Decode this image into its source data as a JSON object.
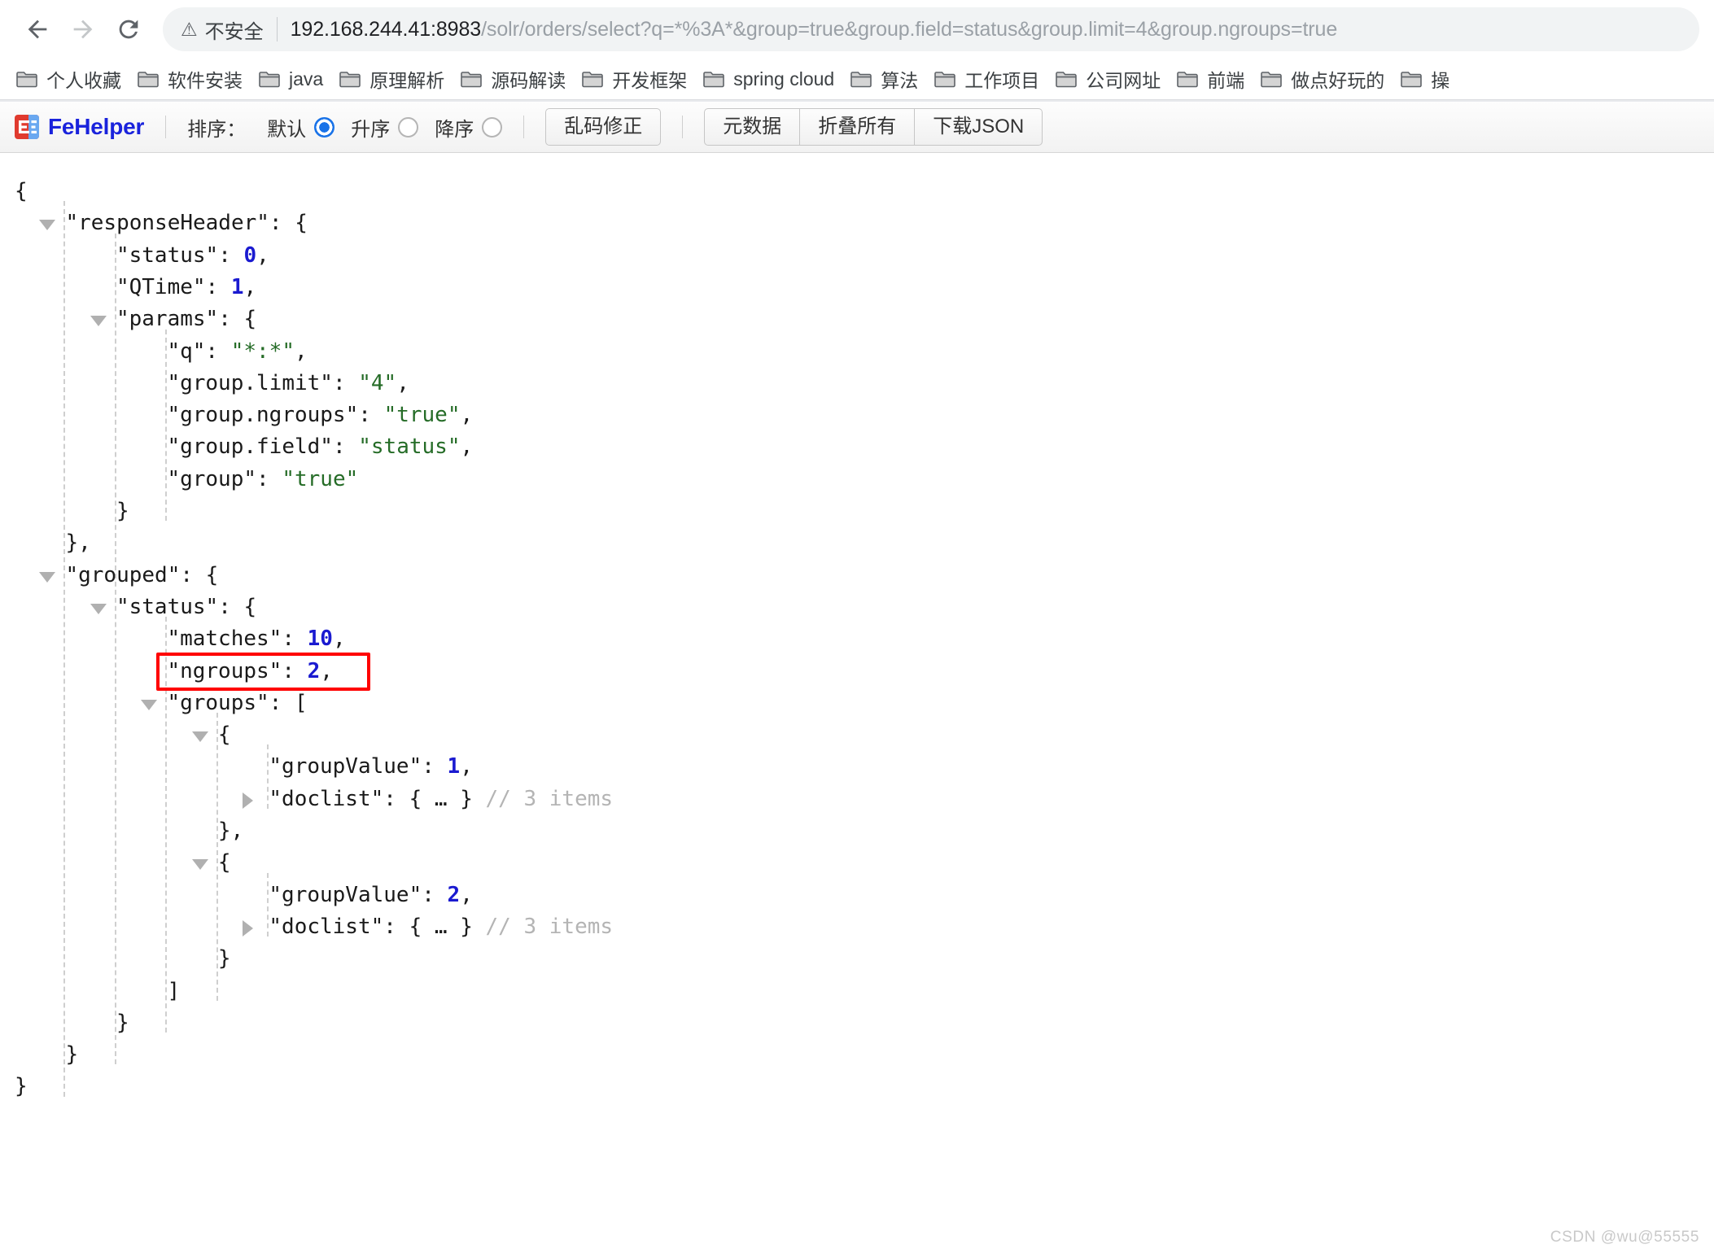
{
  "browser": {
    "back_icon": "back-arrow-icon",
    "forward_icon": "forward-arrow-icon",
    "reload_icon": "reload-icon",
    "security_warning_glyph": "⚠",
    "security_text": "不安全",
    "url_host": "192.168.244.41:8983",
    "url_path": "/solr/orders/select?q=*%3A*&group=true&group.field=status&group.limit=4&group.ngroups=true",
    "url_full": "192.168.244.41:8983/solr/orders/select?q=*%3A*&group=true&group.field=status&group.limit=4&group.ngroups=true"
  },
  "bookmarks": [
    {
      "label": "个人收藏"
    },
    {
      "label": "软件安装"
    },
    {
      "label": "java"
    },
    {
      "label": "原理解析"
    },
    {
      "label": "源码解读"
    },
    {
      "label": "开发框架"
    },
    {
      "label": "spring cloud"
    },
    {
      "label": "算法"
    },
    {
      "label": "工作项目"
    },
    {
      "label": "公司网址"
    },
    {
      "label": "前端"
    },
    {
      "label": "做点好玩的"
    },
    {
      "label": "操"
    }
  ],
  "toolbar": {
    "brand": "FeHelper",
    "logo_text": "FE",
    "sort_label": "排序：",
    "sort_options": [
      {
        "label": "默认",
        "checked": true
      },
      {
        "label": "升序",
        "checked": false
      },
      {
        "label": "降序",
        "checked": false
      }
    ],
    "fix_encoding_button": "乱码修正",
    "metadata_button": "元数据",
    "collapse_all_button": "折叠所有",
    "download_json_button": "下载JSON"
  },
  "json_lines": [
    {
      "indent": 0,
      "fold": "",
      "segs": [
        {
          "t": "{",
          "c": "punc"
        }
      ]
    },
    {
      "indent": 1,
      "fold": "open",
      "segs": [
        {
          "t": "\"responseHeader\"",
          "c": "key"
        },
        {
          "t": ": {",
          "c": "punc"
        }
      ]
    },
    {
      "indent": 2,
      "fold": "",
      "segs": [
        {
          "t": "\"status\"",
          "c": "key"
        },
        {
          "t": ": ",
          "c": "punc"
        },
        {
          "t": "0",
          "c": "num"
        },
        {
          "t": ",",
          "c": "punc"
        }
      ]
    },
    {
      "indent": 2,
      "fold": "",
      "segs": [
        {
          "t": "\"QTime\"",
          "c": "key"
        },
        {
          "t": ": ",
          "c": "punc"
        },
        {
          "t": "1",
          "c": "num"
        },
        {
          "t": ",",
          "c": "punc"
        }
      ]
    },
    {
      "indent": 2,
      "fold": "open",
      "segs": [
        {
          "t": "\"params\"",
          "c": "key"
        },
        {
          "t": ": {",
          "c": "punc"
        }
      ]
    },
    {
      "indent": 3,
      "fold": "",
      "segs": [
        {
          "t": "\"q\"",
          "c": "key"
        },
        {
          "t": ": ",
          "c": "punc"
        },
        {
          "t": "\"*:*\"",
          "c": "str"
        },
        {
          "t": ",",
          "c": "punc"
        }
      ]
    },
    {
      "indent": 3,
      "fold": "",
      "segs": [
        {
          "t": "\"group.limit\"",
          "c": "key"
        },
        {
          "t": ": ",
          "c": "punc"
        },
        {
          "t": "\"4\"",
          "c": "str"
        },
        {
          "t": ",",
          "c": "punc"
        }
      ]
    },
    {
      "indent": 3,
      "fold": "",
      "segs": [
        {
          "t": "\"group.ngroups\"",
          "c": "key"
        },
        {
          "t": ": ",
          "c": "punc"
        },
        {
          "t": "\"true\"",
          "c": "str"
        },
        {
          "t": ",",
          "c": "punc"
        }
      ]
    },
    {
      "indent": 3,
      "fold": "",
      "segs": [
        {
          "t": "\"group.field\"",
          "c": "key"
        },
        {
          "t": ": ",
          "c": "punc"
        },
        {
          "t": "\"status\"",
          "c": "str"
        },
        {
          "t": ",",
          "c": "punc"
        }
      ]
    },
    {
      "indent": 3,
      "fold": "",
      "segs": [
        {
          "t": "\"group\"",
          "c": "key"
        },
        {
          "t": ": ",
          "c": "punc"
        },
        {
          "t": "\"true\"",
          "c": "str"
        }
      ]
    },
    {
      "indent": 2,
      "fold": "",
      "segs": [
        {
          "t": "}",
          "c": "punc"
        }
      ]
    },
    {
      "indent": 1,
      "fold": "",
      "segs": [
        {
          "t": "},",
          "c": "punc"
        }
      ]
    },
    {
      "indent": 1,
      "fold": "open",
      "segs": [
        {
          "t": "\"grouped\"",
          "c": "key"
        },
        {
          "t": ": {",
          "c": "punc"
        }
      ]
    },
    {
      "indent": 2,
      "fold": "open",
      "segs": [
        {
          "t": "\"status\"",
          "c": "key"
        },
        {
          "t": ": {",
          "c": "punc"
        }
      ]
    },
    {
      "indent": 3,
      "fold": "",
      "segs": [
        {
          "t": "\"matches\"",
          "c": "key"
        },
        {
          "t": ": ",
          "c": "punc"
        },
        {
          "t": "10",
          "c": "num"
        },
        {
          "t": ",",
          "c": "punc"
        }
      ]
    },
    {
      "indent": 3,
      "fold": "",
      "highlight": true,
      "segs": [
        {
          "t": "\"ngroups\"",
          "c": "key"
        },
        {
          "t": ": ",
          "c": "punc"
        },
        {
          "t": "2",
          "c": "num"
        },
        {
          "t": ",",
          "c": "punc"
        }
      ]
    },
    {
      "indent": 3,
      "fold": "open",
      "segs": [
        {
          "t": "\"groups\"",
          "c": "key"
        },
        {
          "t": ": [",
          "c": "punc"
        }
      ]
    },
    {
      "indent": 4,
      "fold": "open",
      "segs": [
        {
          "t": "{",
          "c": "punc"
        }
      ]
    },
    {
      "indent": 5,
      "fold": "",
      "segs": [
        {
          "t": "\"groupValue\"",
          "c": "key"
        },
        {
          "t": ": ",
          "c": "punc"
        },
        {
          "t": "1",
          "c": "num"
        },
        {
          "t": ",",
          "c": "punc"
        }
      ]
    },
    {
      "indent": 5,
      "fold": "closed",
      "segs": [
        {
          "t": "\"doclist\"",
          "c": "key"
        },
        {
          "t": ": { … } ",
          "c": "punc"
        },
        {
          "t": "// 3 items",
          "c": "cmt"
        }
      ]
    },
    {
      "indent": 4,
      "fold": "",
      "segs": [
        {
          "t": "},",
          "c": "punc"
        }
      ]
    },
    {
      "indent": 4,
      "fold": "open",
      "segs": [
        {
          "t": "{",
          "c": "punc"
        }
      ]
    },
    {
      "indent": 5,
      "fold": "",
      "segs": [
        {
          "t": "\"groupValue\"",
          "c": "key"
        },
        {
          "t": ": ",
          "c": "punc"
        },
        {
          "t": "2",
          "c": "num"
        },
        {
          "t": ",",
          "c": "punc"
        }
      ]
    },
    {
      "indent": 5,
      "fold": "closed",
      "segs": [
        {
          "t": "\"doclist\"",
          "c": "key"
        },
        {
          "t": ": { … } ",
          "c": "punc"
        },
        {
          "t": "// 3 items",
          "c": "cmt"
        }
      ]
    },
    {
      "indent": 4,
      "fold": "",
      "segs": [
        {
          "t": "}",
          "c": "punc"
        }
      ]
    },
    {
      "indent": 3,
      "fold": "",
      "segs": [
        {
          "t": "]",
          "c": "punc"
        }
      ]
    },
    {
      "indent": 2,
      "fold": "",
      "segs": [
        {
          "t": "}",
          "c": "punc"
        }
      ]
    },
    {
      "indent": 1,
      "fold": "",
      "segs": [
        {
          "t": "}",
          "c": "punc"
        }
      ]
    },
    {
      "indent": 0,
      "fold": "",
      "segs": [
        {
          "t": "}",
          "c": "punc"
        }
      ]
    }
  ],
  "indent_guides": [
    {
      "indent": 1,
      "from": 1,
      "to": 28
    },
    {
      "indent": 2,
      "from": 2,
      "to": 27
    },
    {
      "indent": 3,
      "from": 5,
      "to": 10
    },
    {
      "indent": 3,
      "from": 14,
      "to": 26
    },
    {
      "indent": 4,
      "from": 17,
      "to": 25
    },
    {
      "indent": 5,
      "from": 18,
      "to": 19
    },
    {
      "indent": 5,
      "from": 22,
      "to": 23
    }
  ],
  "watermark": "CSDN @wu@55555",
  "colors": {
    "accent_blue": "#1a73e8",
    "brand_blue": "#1a23dc",
    "json_number": "#1a1ad0",
    "json_string": "#256c27",
    "highlight_red": "#ff0000",
    "omnibox_bg": "#f1f3f4"
  }
}
